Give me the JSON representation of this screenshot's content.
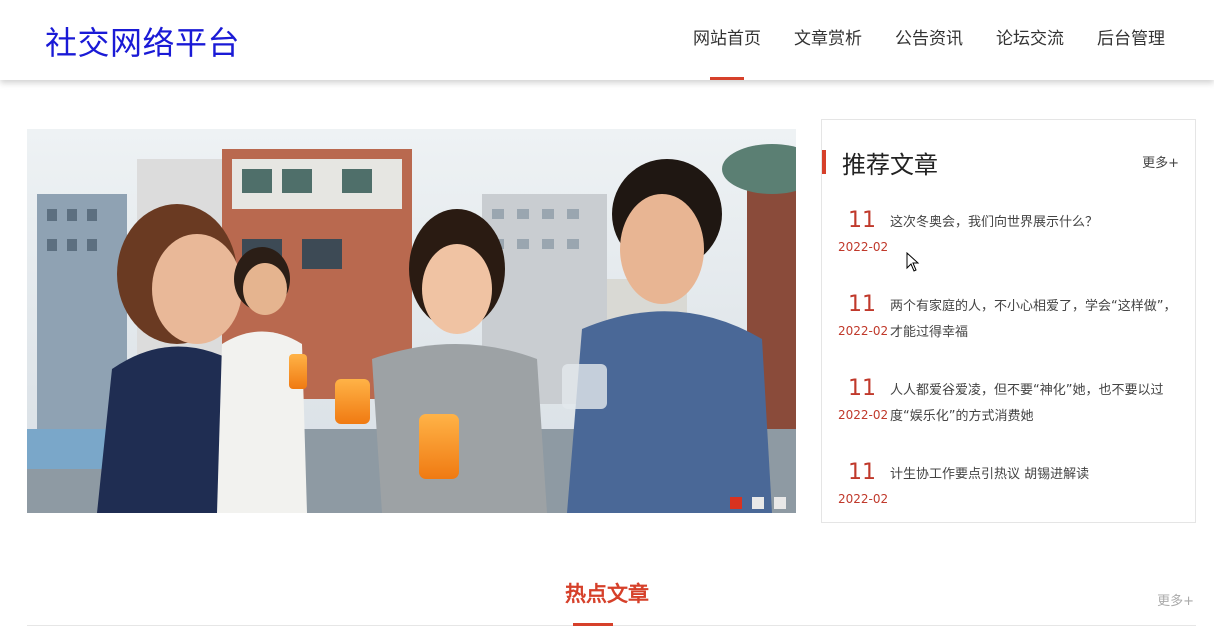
{
  "header": {
    "logo": "社交网络平台",
    "nav": [
      {
        "label": "网站首页",
        "active": true
      },
      {
        "label": "文章赏析",
        "active": false
      },
      {
        "label": "公告资讯",
        "active": false
      },
      {
        "label": "论坛交流",
        "active": false
      },
      {
        "label": "后台管理",
        "active": false
      }
    ]
  },
  "carousel": {
    "slide_count": 3,
    "active_index": 0
  },
  "recommend": {
    "title": "推荐文章",
    "more": "更多+",
    "articles": [
      {
        "day": "11",
        "ym": "2022-02",
        "title": "这次冬奥会，我们向世界展示什么？"
      },
      {
        "day": "11",
        "ym": "2022-02",
        "title": "两个有家庭的人，不小心相爱了，学会“这样做”，才能过得幸福"
      },
      {
        "day": "11",
        "ym": "2022-02",
        "title": "人人都爱谷爱凌，但不要“神化”她，也不要以过度“娱乐化”的方式消费她"
      },
      {
        "day": "11",
        "ym": "2022-02",
        "title": "计生协工作要点引热议 胡锡进解读"
      }
    ]
  },
  "hot": {
    "title": "热点文章",
    "more": "更多+"
  },
  "colors": {
    "accent": "#d6402a",
    "logo": "#1a1ad6",
    "date": "#c0392b"
  }
}
